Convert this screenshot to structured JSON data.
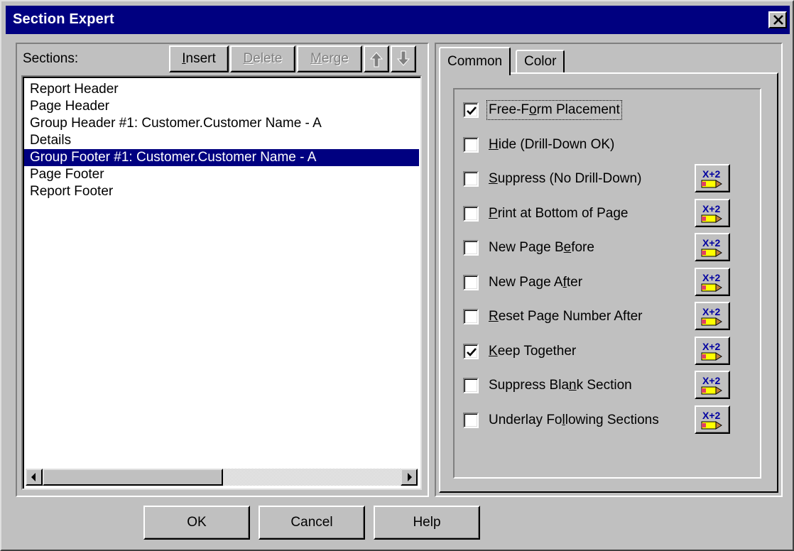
{
  "window": {
    "title": "Section Expert"
  },
  "sections_panel": {
    "label": "Sections:",
    "buttons": {
      "insert": {
        "label": "Insert",
        "hotkey": "I",
        "rest": "nsert"
      },
      "delete": {
        "label": "Delete",
        "hotkey": "D",
        "rest": "elete"
      },
      "merge": {
        "label": "Merge",
        "hotkey": "M",
        "rest": "erge"
      }
    },
    "items": [
      "Report Header",
      "Page Header",
      "Group Header #1: Customer.Customer Name - A",
      "Details",
      "Group Footer #1: Customer.Customer Name - A",
      "Page Footer",
      "Report Footer"
    ],
    "selected_index": 4
  },
  "tabs": [
    {
      "label": "Common",
      "active": true
    },
    {
      "label": "Color",
      "active": false
    }
  ],
  "options": [
    {
      "pre": "Free-F",
      "key": "o",
      "post": "rm Placement",
      "checked": true,
      "formula": false
    },
    {
      "pre": "",
      "key": "H",
      "post": "ide (Drill-Down OK)",
      "checked": false,
      "formula": false
    },
    {
      "pre": "",
      "key": "S",
      "post": "uppress (No Drill-Down)",
      "checked": false,
      "formula": true
    },
    {
      "pre": "",
      "key": "P",
      "post": "rint at Bottom of Page",
      "checked": false,
      "formula": true
    },
    {
      "pre": "New Page B",
      "key": "e",
      "post": "fore",
      "checked": false,
      "formula": true
    },
    {
      "pre": "New Page A",
      "key": "f",
      "post": "ter",
      "checked": false,
      "formula": true
    },
    {
      "pre": "",
      "key": "R",
      "post": "eset Page Number After",
      "checked": false,
      "formula": true
    },
    {
      "pre": "",
      "key": "K",
      "post": "eep Together",
      "checked": true,
      "formula": true
    },
    {
      "pre": "Suppress Bla",
      "key": "n",
      "post": "k Section",
      "checked": false,
      "formula": true
    },
    {
      "pre": "Underlay Fo",
      "key": "l",
      "post": "lowing Sections",
      "checked": false,
      "formula": true
    }
  ],
  "formula_icon_text": "X+2",
  "footer_buttons": {
    "ok": "OK",
    "cancel": "Cancel",
    "help": "Help"
  }
}
